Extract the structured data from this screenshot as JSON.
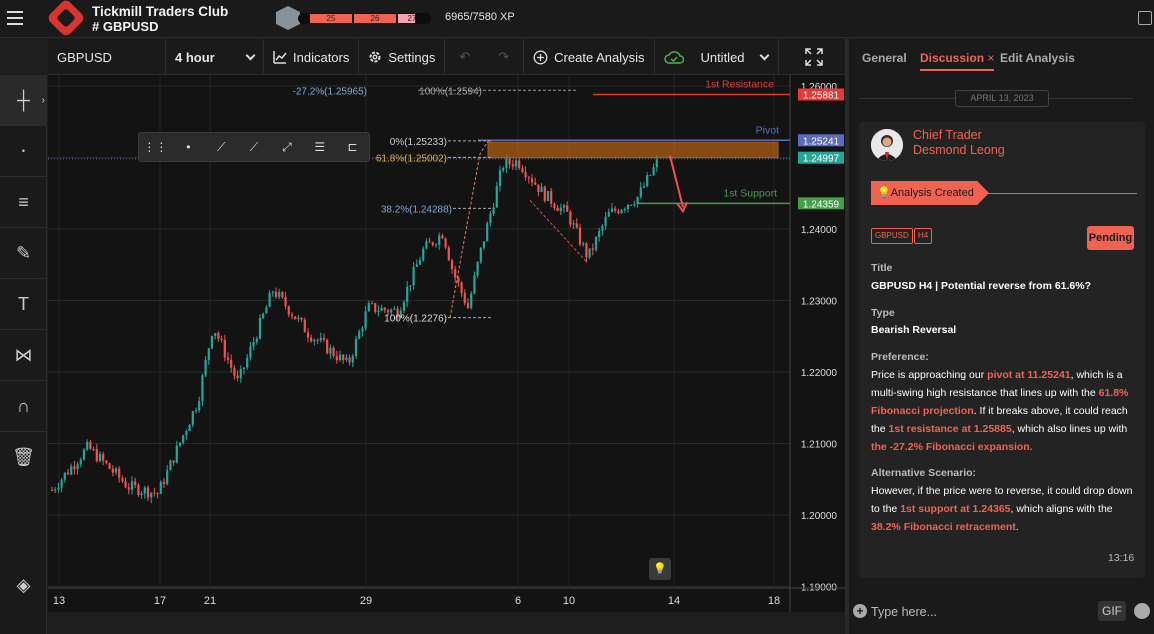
{
  "app": {
    "title": "Tickmill Traders Club",
    "channel": "GBPUSD",
    "channel_prefix": "#"
  },
  "xp": {
    "segments": [
      "25",
      "26",
      "27"
    ],
    "text": "6965/7580 XP"
  },
  "toolbar": {
    "symbol": "GBPUSD",
    "timeframe": "4 hour",
    "indicators": "Indicators",
    "settings": "Settings",
    "create": "Create Analysis",
    "untitled": "Untitled"
  },
  "chart": {
    "prices": [
      "1.26000",
      "1.25000",
      "1.24000",
      "1.23000",
      "1.22000",
      "1.21000",
      "1.20000",
      "1.19000"
    ],
    "dates": [
      "13",
      "17",
      "21",
      "29",
      "6",
      "10",
      "14",
      "18"
    ],
    "markers": {
      "resistance": "1.25881",
      "pivot": "1.25241",
      "last": "1.24997",
      "support": "1.24359"
    },
    "labels": {
      "resistance": "1st Resistance",
      "pivot": "Pivot",
      "support": "1st Support"
    },
    "fib": {
      "ext": "-27.2%(1.25965)",
      "f100top": "100%(1.2594)",
      "f0": "0%(1.25233)",
      "f618": "61.8%(1.25002)",
      "f382": "38.2%(1.24288)",
      "f100": "100%(1.2276)"
    },
    "colors": {
      "up": "#26a69a",
      "down": "#ef5350",
      "resistance": "#e53935",
      "pivot": "#5c6bc0",
      "support": "#43a047"
    }
  },
  "panel": {
    "tabs": [
      "General",
      "Discussion",
      "Edit Analysis"
    ],
    "tab_close": "×",
    "date": "APRIL 13, 2023",
    "author": {
      "role": "Chief Trader",
      "name": "Desmond Leong"
    },
    "event": "Analysis Created",
    "tags": [
      "GBPUSD",
      "H4"
    ],
    "status": "Pending",
    "title_label": "Title",
    "title": "GBPUSD H4 | Potential reverse from 61.6%?",
    "type_label": "Type",
    "type": "Bearish Reversal",
    "pref_label": "Preference:",
    "pref": {
      "t1": "Price is approaching our ",
      "h1": "pivot at 11.25241",
      "t2": ", which is a multi-swing high resistance that lines up with the ",
      "h2": "61.8% Fibonacci projection",
      "t3": ". If it breaks above, it could reach the ",
      "h3": "1st resistance at 1.25885",
      "t4": ", which also lines up with ",
      "h4": "the -27.2% Fibonacci expansion."
    },
    "alt_label": "Alternative Scenario:",
    "alt": {
      "t1": "However, if the price were to reverse, it could drop down to the ",
      "h1": "1st support at 1.24365",
      "t2": ", which aligns with the ",
      "h2": "38.2% Fibonacci retracement",
      "t3": "."
    },
    "time": "13:16",
    "input_placeholder": "Type here...",
    "gif": "GIF"
  }
}
